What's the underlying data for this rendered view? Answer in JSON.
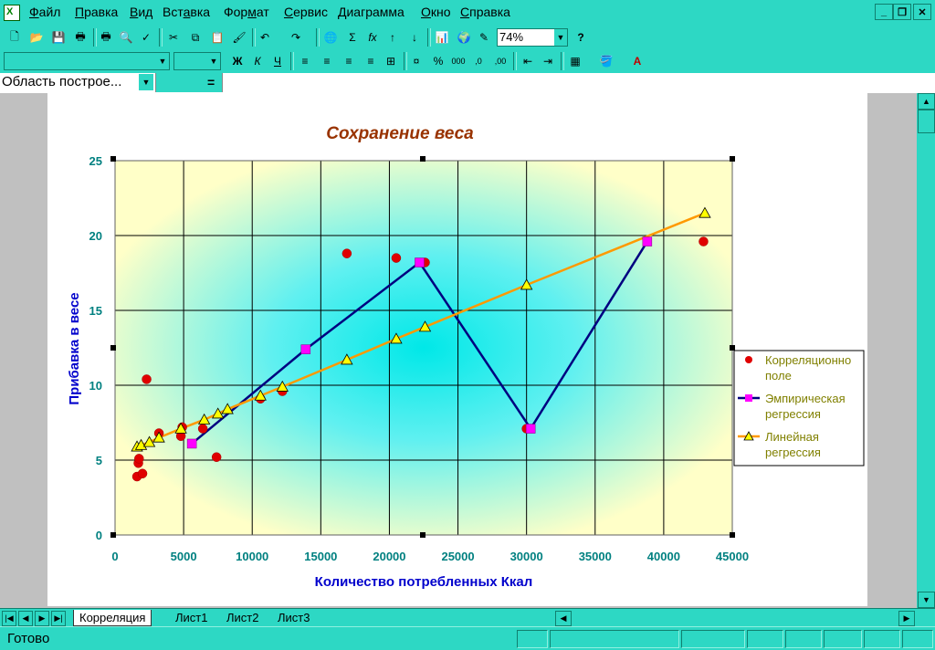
{
  "menubar": {
    "items": [
      {
        "label": "Файл",
        "u": "Ф"
      },
      {
        "label": "Правка",
        "u": "П"
      },
      {
        "label": "Вид",
        "u": "В"
      },
      {
        "label": "Вставка",
        "u": "а"
      },
      {
        "label": "Формат",
        "u": "м"
      },
      {
        "label": "Сервис",
        "u": "С"
      },
      {
        "label": "Диаграмма",
        "u": "Д"
      },
      {
        "label": "Окно",
        "u": "О"
      },
      {
        "label": "Справка",
        "u": "С"
      }
    ]
  },
  "toolbar": {
    "zoom_value": "74%"
  },
  "formula": {
    "name_box": "Область построе...",
    "equals": "="
  },
  "chart_data": {
    "type": "scatter",
    "title": "Сохранение веса",
    "xlabel": "Количество потребленных Ккал",
    "ylabel": "Прибавка в весе",
    "xlim": [
      0,
      45000
    ],
    "ylim": [
      0,
      25
    ],
    "xticks": [
      0,
      5000,
      10000,
      15000,
      20000,
      25000,
      30000,
      35000,
      40000,
      45000
    ],
    "yticks": [
      0,
      5,
      10,
      15,
      20,
      25
    ],
    "grid": true,
    "legend_position": "right",
    "series": [
      {
        "name": "Корреляционное поле",
        "kind": "scatter",
        "color": "#e00000",
        "x": [
          1600,
          1700,
          1750,
          2000,
          2300,
          3200,
          4800,
          4900,
          6400,
          7400,
          10600,
          12200,
          16900,
          20500,
          22600,
          30000,
          42900
        ],
        "y": [
          3.9,
          4.8,
          5.1,
          4.1,
          10.4,
          6.8,
          6.6,
          7.2,
          7.1,
          5.2,
          9.1,
          9.6,
          18.8,
          18.5,
          18.2,
          7.1,
          19.6
        ]
      },
      {
        "name": "Эмпирическая регрессия",
        "kind": "line",
        "color": "#000080",
        "marker_color": "#ff00ff",
        "x": [
          5600,
          13900,
          22200,
          30300,
          38800
        ],
        "y": [
          6.1,
          12.4,
          18.2,
          7.1,
          19.6
        ]
      },
      {
        "name": "Линейная регрессия",
        "kind": "line",
        "color": "#ff9900",
        "marker_color": "#ffff00",
        "x": [
          1600,
          1900,
          2500,
          3200,
          4800,
          6500,
          7500,
          8200,
          10600,
          12200,
          16900,
          20500,
          22600,
          30000,
          43000
        ],
        "y": [
          5.9,
          6.0,
          6.2,
          6.5,
          7.1,
          7.7,
          8.1,
          8.4,
          9.3,
          9.9,
          11.7,
          13.1,
          13.9,
          16.7,
          21.5
        ]
      }
    ],
    "legend_labels": [
      {
        "line1": "Корреляционно",
        "line2": "поле"
      },
      {
        "line1": "Эмпирическая",
        "line2": "регрессия"
      },
      {
        "line1": "Линейная",
        "line2": "регрессия"
      }
    ]
  },
  "sheets": {
    "tabs": [
      "Корреляция",
      "Лист1",
      "Лист2",
      "Лист3"
    ],
    "active": 0
  },
  "status": {
    "text": "Готово"
  },
  "colors": {
    "chrome": "#2dd8c4",
    "plot_bg": "#ffffc8",
    "plot_center": "#00e8e8",
    "title": "#993300",
    "axis_title": "#0000cc",
    "tick": "#008080"
  }
}
